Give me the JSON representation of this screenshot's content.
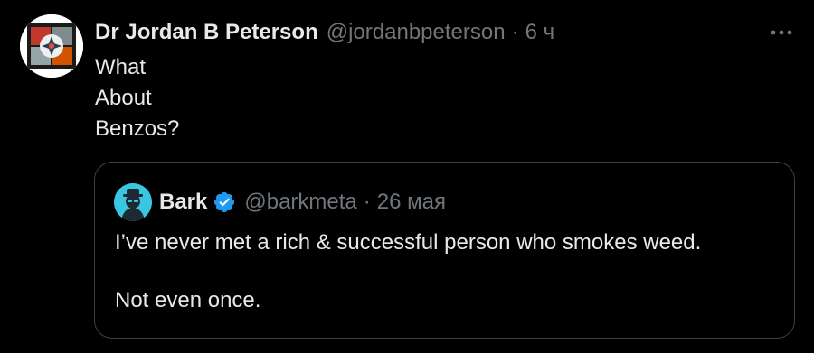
{
  "tweet": {
    "author": {
      "display_name": "Dr Jordan B Peterson",
      "handle": "@jordanbpeterson",
      "separator": "·",
      "time": "6 ч"
    },
    "more_icon": "more-horizontal-icon",
    "body_lines": [
      "What",
      "About",
      "Benzos?"
    ],
    "quoted": {
      "author": {
        "display_name": "Bark",
        "verified": true,
        "verified_color": "#1d9bf0",
        "handle": "@barkmeta",
        "separator": "·",
        "time": "26 мая"
      },
      "text_line_1": "I’ve never met a rich & successful person who smokes weed.",
      "text_line_2": "Not even once."
    }
  },
  "colors": {
    "background": "#000000",
    "primary_text": "#e7e9ea",
    "secondary_text": "#71767b",
    "border": "#3e4144",
    "accent": "#1d9bf0"
  }
}
